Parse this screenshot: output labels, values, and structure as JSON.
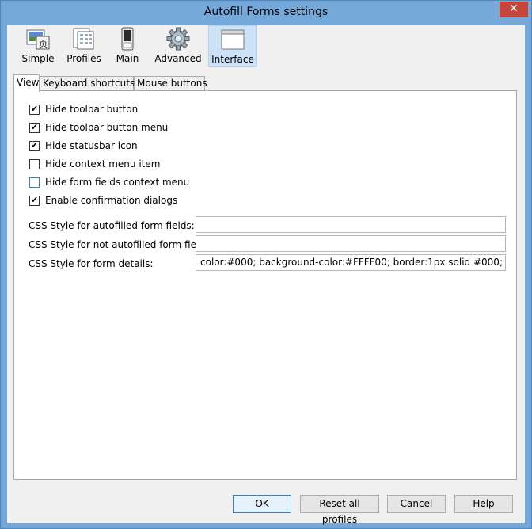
{
  "window": {
    "title": "Autofill Forms settings",
    "close_glyph": "✕"
  },
  "toolbar": {
    "items": [
      {
        "label": "Simple",
        "icon": "simple-icon"
      },
      {
        "label": "Profiles",
        "icon": "profiles-icon"
      },
      {
        "label": "Main",
        "icon": "main-icon"
      },
      {
        "label": "Advanced",
        "icon": "gear-icon"
      },
      {
        "label": "Interface",
        "icon": "window-icon",
        "selected": true
      }
    ]
  },
  "tabs": [
    {
      "label": "View",
      "active": true
    },
    {
      "label": "Keyboard shortcuts"
    },
    {
      "label": "Mouse buttons"
    }
  ],
  "view": {
    "options": [
      {
        "label": "Hide toolbar button",
        "checked": true
      },
      {
        "label": "Hide toolbar button menu",
        "checked": true
      },
      {
        "label": "Hide statusbar icon",
        "checked": true
      },
      {
        "label": "Hide context menu item",
        "checked": false
      },
      {
        "label": "Hide form fields context menu",
        "checked": false
      },
      {
        "label": "Enable confirmation dialogs",
        "checked": true
      }
    ],
    "css_fields": [
      {
        "label": "CSS Style for autofilled form fields:",
        "value": ""
      },
      {
        "label": "CSS Style for not autofilled form fields:",
        "value": ""
      },
      {
        "label": "CSS Style for form details:",
        "value": "color:#000; background-color:#FFFF00; border:1px solid #000;"
      }
    ]
  },
  "buttons": {
    "ok": "OK",
    "reset": "Reset all profiles",
    "cancel": "Cancel",
    "help_first": "H",
    "help_rest": "elp"
  },
  "check_glyph": "✔"
}
